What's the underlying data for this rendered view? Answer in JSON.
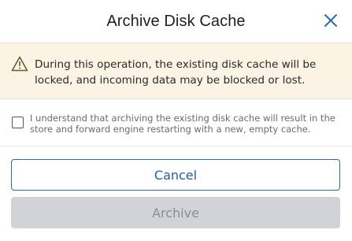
{
  "dialog": {
    "title": "Archive Disk Cache",
    "close_icon": "close-icon",
    "warning": {
      "icon": "warning-icon",
      "text": "During this operation, the existing disk cache will be locked, and incoming data may be blocked or lost."
    },
    "confirm": {
      "checked": false,
      "label": "I understand that archiving the existing disk cache will result in the store and forward engine restarting with a new, empty cache."
    },
    "buttons": {
      "cancel_label": "Cancel",
      "archive_label": "Archive",
      "archive_disabled": true
    }
  },
  "colors": {
    "accent": "#1f5fa8",
    "warning_bg": "#fbf3e3",
    "disabled_bg": "#d1d3d6",
    "disabled_text": "#8b8e93"
  }
}
